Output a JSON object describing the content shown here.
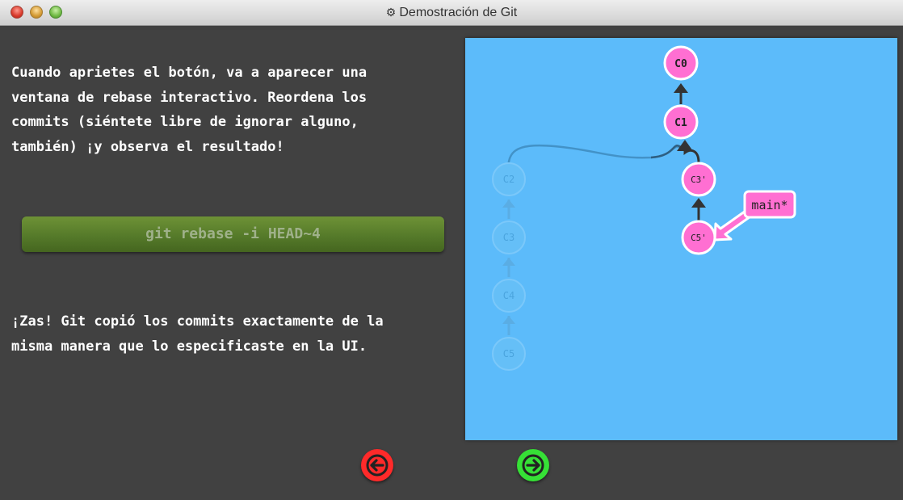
{
  "window": {
    "title": "Demostración de Git",
    "title_icon": "gear-icon"
  },
  "content": {
    "intro_text": "Cuando aprietes el botón, va a aparecer una ventana de rebase interactivo. Reordena los commits (siéntete libre de ignorar alguno, también) ¡y observa el resultado!",
    "command_label": "git rebase -i HEAD~4",
    "outro_text": "¡Zas! Git copió los commits exactamente de la misma manera que lo especificaste en la UI."
  },
  "graph": {
    "commits": [
      {
        "id": "C0",
        "label": "C0",
        "state": "active"
      },
      {
        "id": "C1",
        "label": "C1",
        "state": "active"
      },
      {
        "id": "C2",
        "label": "C2",
        "state": "faded"
      },
      {
        "id": "C3",
        "label": "C3",
        "state": "faded"
      },
      {
        "id": "C4",
        "label": "C4",
        "state": "faded"
      },
      {
        "id": "C5",
        "label": "C5",
        "state": "faded"
      },
      {
        "id": "C3p",
        "label": "C3'",
        "state": "active"
      },
      {
        "id": "C5p",
        "label": "C5'",
        "state": "active"
      }
    ],
    "branch": {
      "name": "main*",
      "points_to": "C5'"
    }
  },
  "navigation": {
    "back_icon": "arrow-left-icon",
    "forward_icon": "arrow-right-icon"
  },
  "colors": {
    "background": "#414141",
    "visual_background": "#5cbbfa",
    "commit_fill": "#ff6fd2",
    "commit_faded": "#6ec4f5",
    "back_button": "#ff2a2a",
    "forward_button": "#36e036",
    "command_button": "#557a2a"
  }
}
